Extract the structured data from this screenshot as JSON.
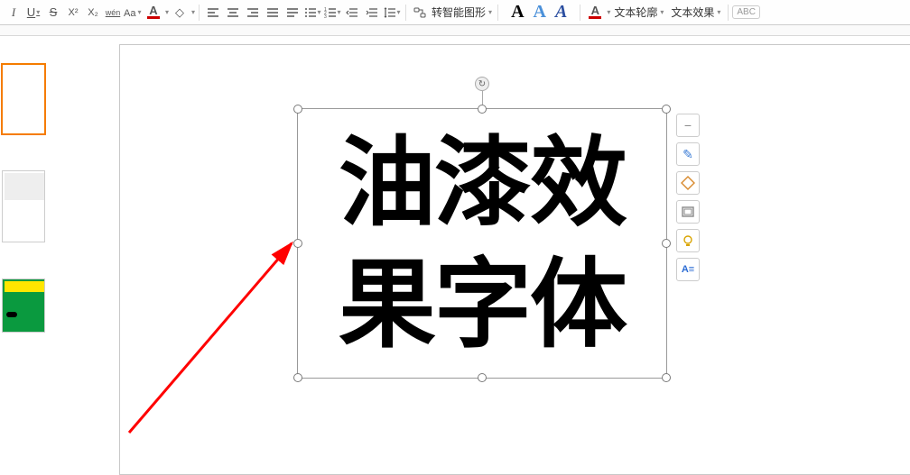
{
  "toolbar": {
    "italic": "I",
    "underline": "U",
    "strike": "S",
    "superscript": "X²",
    "subscript": "X₂",
    "pinyin": "wén",
    "font_color_letter": "A",
    "highlight_letter": "A",
    "smartshape": "转智能图形",
    "text_outline": "文本轮廓",
    "text_effect": "文本效果",
    "abc": "ABC"
  },
  "styles": {
    "s1": "A",
    "s2": "A",
    "s3": "A"
  },
  "textbox": {
    "content": "油漆效果字体"
  },
  "float_tools": {
    "minus": "−",
    "brush": "✎",
    "shape": "◇",
    "frame": "▭",
    "idea": "💡",
    "format": "A"
  }
}
